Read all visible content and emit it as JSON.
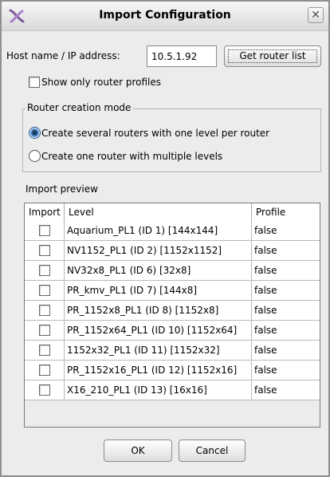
{
  "dialog": {
    "title": "Import Configuration",
    "close_label": "✕"
  },
  "host": {
    "label": "Host name / IP address:",
    "value": "10.5.1.92",
    "get_router_list_label": "Get router list"
  },
  "show_only_profiles": {
    "label": "Show only router profiles",
    "checked": false
  },
  "router_creation_mode": {
    "legend": "Router creation mode",
    "options": [
      {
        "label": "Create several routers with one level per router",
        "selected": true
      },
      {
        "label": "Create one router with multiple levels",
        "selected": false
      }
    ]
  },
  "import_preview": {
    "label": "Import preview",
    "columns": [
      "Import",
      "Level",
      "Profile"
    ],
    "rows": [
      {
        "import": false,
        "level": "Aquarium_PL1 (ID 1) [144x144]",
        "profile": "false"
      },
      {
        "import": false,
        "level": "NV1152_PL1 (ID 2) [1152x1152]",
        "profile": "false"
      },
      {
        "import": false,
        "level": "NV32x8_PL1 (ID 6) [32x8]",
        "profile": "false"
      },
      {
        "import": false,
        "level": "PR_kmv_PL1 (ID 7) [144x8]",
        "profile": "false"
      },
      {
        "import": false,
        "level": "PR_1152x8_PL1 (ID 8) [1152x8]",
        "profile": "false"
      },
      {
        "import": false,
        "level": "PR_1152x64_PL1 (ID 10) [1152x64]",
        "profile": "false"
      },
      {
        "import": false,
        "level": "1152x32_PL1 (ID 11) [1152x32]",
        "profile": "false"
      },
      {
        "import": false,
        "level": "PR_1152x16_PL1 (ID 12) [1152x16]",
        "profile": "false"
      },
      {
        "import": false,
        "level": "X16_210_PL1 (ID 13) [16x16]",
        "profile": "false"
      }
    ]
  },
  "footer": {
    "ok_label": "OK",
    "cancel_label": "Cancel"
  }
}
